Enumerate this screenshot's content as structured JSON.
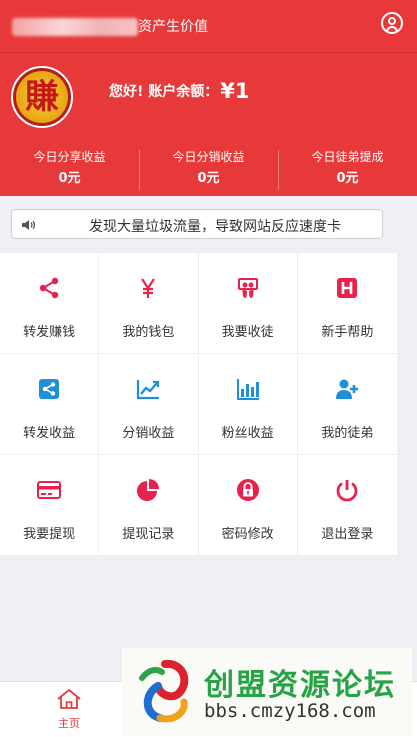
{
  "header": {
    "title": "资产生价值"
  },
  "profile": {
    "avatar_char": "賺",
    "greeting": "您好! 账户余额：",
    "balance": "¥1"
  },
  "stats": [
    {
      "label": "今日分享收益",
      "value": "0元"
    },
    {
      "label": "今日分销收益",
      "value": "0元"
    },
    {
      "label": "今日徒弟提成",
      "value": "0元"
    }
  ],
  "notice": {
    "text": "发现大量垃圾流量，导致网站反应速度卡"
  },
  "menu": [
    {
      "label": "转发赚钱",
      "icon": "share-icon",
      "color": "#e8214d"
    },
    {
      "label": "我的钱包",
      "icon": "yen-icon",
      "color": "#e8214d"
    },
    {
      "label": "我要收徒",
      "icon": "slideshare-icon",
      "color": "#e8214d"
    },
    {
      "label": "新手帮助",
      "icon": "hospital-h-icon",
      "color": "#e8214d"
    },
    {
      "label": "转发收益",
      "icon": "share-square-icon",
      "color": "#1e90d8"
    },
    {
      "label": "分销收益",
      "icon": "line-chart-icon",
      "color": "#1e90d8"
    },
    {
      "label": "粉丝收益",
      "icon": "bar-chart-icon",
      "color": "#1e90d8"
    },
    {
      "label": "我的徒弟",
      "icon": "user-plus-icon",
      "color": "#1e90d8"
    },
    {
      "label": "我要提现",
      "icon": "credit-card-icon",
      "color": "#e8214d"
    },
    {
      "label": "提现记录",
      "icon": "pie-chart-icon",
      "color": "#e8214d"
    },
    {
      "label": "密码修改",
      "icon": "lock-icon",
      "color": "#e8214d"
    },
    {
      "label": "退出登录",
      "icon": "power-icon",
      "color": "#e8214d"
    }
  ],
  "tabbar": {
    "home_label": "主页"
  },
  "watermark": {
    "name": "创盟资源论坛",
    "url": "bbs.cmzy168.com"
  }
}
